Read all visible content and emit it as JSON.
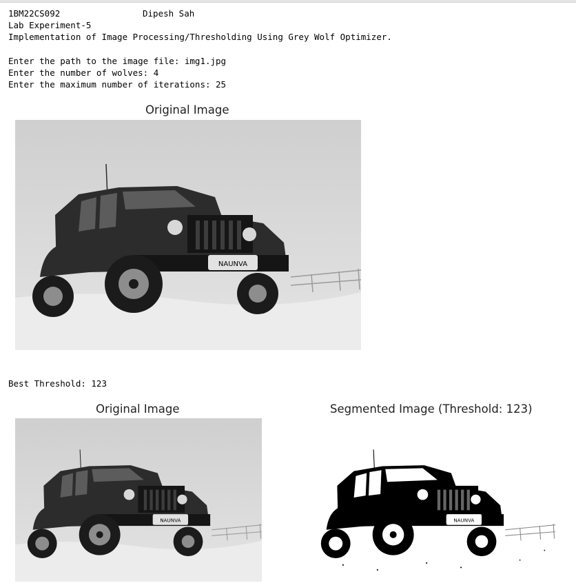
{
  "header": {
    "usn": "1BM22CS092",
    "name": "Dipesh Sah",
    "lab": "Lab Experiment-5",
    "description": "Implementation of Image Processing/Thresholding Using Grey Wolf Optimizer."
  },
  "inputs": {
    "path_line": "Enter the path to the image file: img1.jpg",
    "wolves_line": "Enter the number of wolves: 4",
    "iterations_line": "Enter the maximum number of iterations: 25"
  },
  "figure1": {
    "title": "Original Image"
  },
  "result": {
    "best_threshold_line": "Best Threshold: 123"
  },
  "figure2": {
    "left_title": "Original Image",
    "right_title": "Segmented Image (Threshold: 123)"
  },
  "plate_text": "NAUNVA"
}
